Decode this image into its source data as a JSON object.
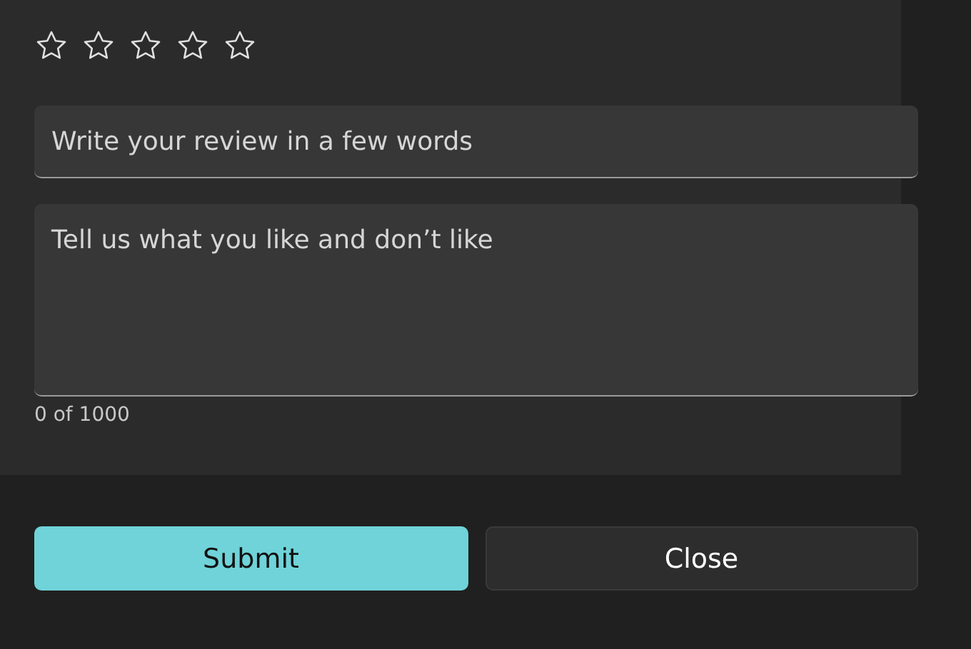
{
  "rating": {
    "stars": 0
  },
  "title_field": {
    "placeholder": "Write your review in a few words"
  },
  "review_field": {
    "placeholder": "Tell us what you like and don’t like"
  },
  "counter": "0 of 1000",
  "buttons": [
    {
      "label": "Submit",
      "kind": "primary"
    },
    {
      "label": "Close",
      "kind": "secondary"
    }
  ]
}
